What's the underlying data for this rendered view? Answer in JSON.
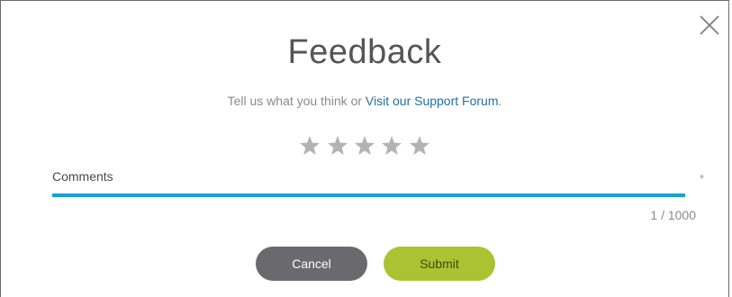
{
  "dialog": {
    "title": "Feedback",
    "subtitle_prefix": "Tell us what you think or ",
    "subtitle_link": "Visit our Support Forum",
    "subtitle_suffix": ".",
    "rating": {
      "max_stars": 5,
      "selected": 0,
      "star_color": "#b3b3b3"
    },
    "comments": {
      "label": "Comments",
      "required_marker": "*",
      "value": "",
      "counter": "1 / 1000",
      "accent_color": "#12a2d4"
    },
    "buttons": {
      "cancel_label": "Cancel",
      "submit_label": "Submit",
      "cancel_color": "#6a6a6e",
      "submit_color": "#abc232"
    },
    "close_icon": "close-icon"
  }
}
